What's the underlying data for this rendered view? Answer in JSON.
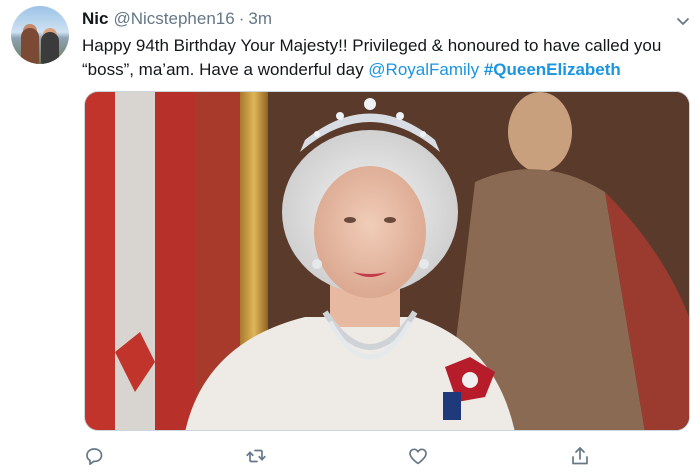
{
  "tweet": {
    "author_name": "Nic",
    "author_handle": "@Nicstephen16",
    "separator": "·",
    "timestamp": "3m",
    "text_main": "Happy 94th Birthday Your Majesty!! Privileged & honoured to have called you “boss”, ma’am. Have a wonderful day ",
    "mention": "@RoyalFamily",
    "hashtag": "#QueenElizabeth"
  },
  "icons": {
    "menu": "chevron-down-icon",
    "reply": "reply-icon",
    "retweet": "retweet-icon",
    "like": "like-icon",
    "share": "share-icon"
  },
  "colors": {
    "link": "#1b95e0",
    "secondary_text": "#657786",
    "icon": "#657786"
  }
}
